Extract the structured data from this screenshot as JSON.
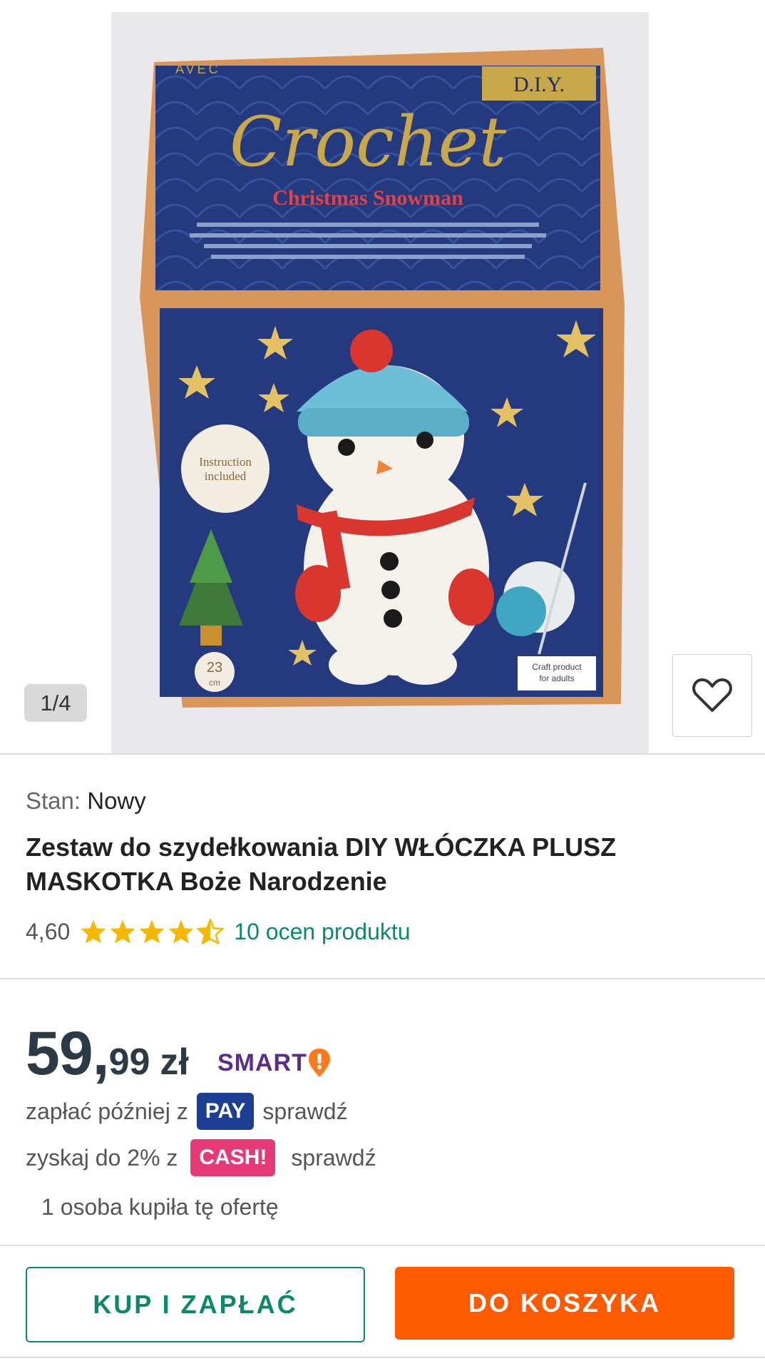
{
  "gallery": {
    "counter": "1/4",
    "box_text": {
      "brand": "AVEC",
      "diy": "D.I.Y.",
      "crochet": "Crochet",
      "subtitle": "Christmas Snowman",
      "instruction": [
        "Instruction",
        "included"
      ],
      "size": "23",
      "size_unit": "cm",
      "craft": [
        "Craft product",
        "for adults"
      ]
    }
  },
  "condition": {
    "label": "Stan:",
    "value": "Nowy"
  },
  "product": {
    "title": "Zestaw do szydełkowania DIY WŁÓCZKA PLUSZ MASKOTKA Boże Narodzenie",
    "rating_value": "4,60",
    "rating_count": "10 ocen produktu",
    "stars": 4.6
  },
  "price": {
    "integer": "59,",
    "decimals": "99",
    "currency": "zł",
    "smart": "SMART"
  },
  "pay_later": {
    "prefix": "zapłać później z",
    "badge": "PAY",
    "link": "sprawdź"
  },
  "cashback": {
    "prefix": "zyskaj do 2% z",
    "badge": "CASH!",
    "link": "sprawdź"
  },
  "buyers": "1 osoba kupiła tę ofertę",
  "actions": {
    "buy_now": "KUP I ZAPŁAĆ",
    "add_to_cart": "DO KOSZYKA"
  },
  "colors": {
    "accent_green": "#0a8a6a",
    "cart_orange": "#ff5a00",
    "pay_blue": "#1c3f94",
    "cash_pink": "#e63a77",
    "smart_purple": "#5a2d8a",
    "star_yellow": "#f5b800"
  }
}
